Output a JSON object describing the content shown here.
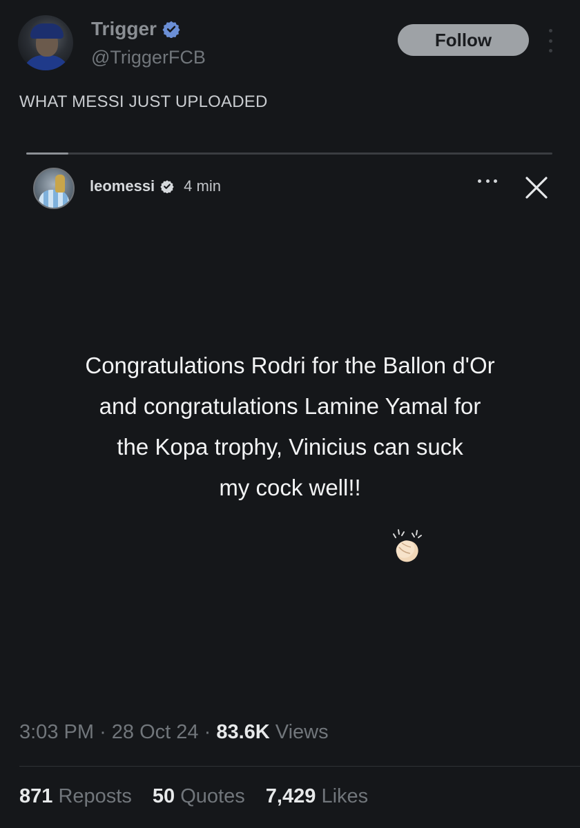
{
  "author": {
    "display_name": "Trigger",
    "handle": "@TriggerFCB",
    "follow_label": "Follow",
    "verified_color": "#6b8fd6"
  },
  "tweet": {
    "text": "WHAT MESSI JUST UPLOADED"
  },
  "story": {
    "progress": 0.08,
    "username": "leomessi",
    "time": "4 min",
    "message_lines": [
      "Congratulations Rodri for the Ballon d'Or",
      "and congratulations Lamine Yamal for",
      "the Kopa trophy, Vinicius can suck",
      "my cock well!!"
    ],
    "emoji_icon": "clapping-hands-icon"
  },
  "meta": {
    "time": "3:03 PM",
    "date": "28 Oct 24",
    "views_count": "83.6K",
    "views_label": "Views",
    "separator": "·"
  },
  "stats": {
    "reposts_count": "871",
    "reposts_label": "Reposts",
    "quotes_count": "50",
    "quotes_label": "Quotes",
    "likes_count": "7,429",
    "likes_label": "Likes"
  }
}
